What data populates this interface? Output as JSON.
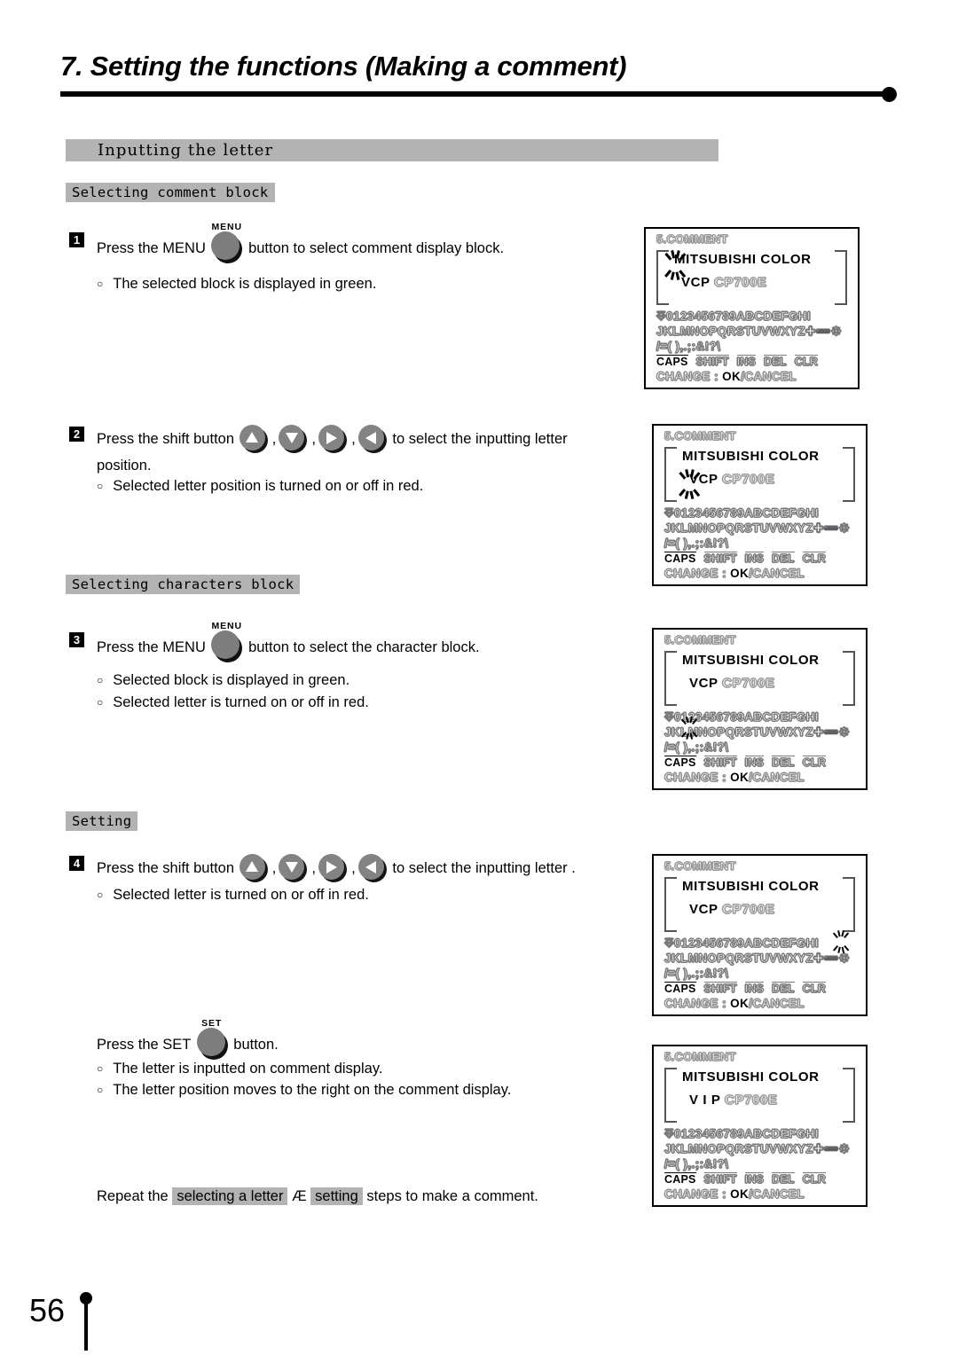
{
  "page": {
    "title": "7. Setting the functions (Making a comment)",
    "number": "56"
  },
  "sections": {
    "main_bar": "Inputting the letter",
    "selecting_comment_block": "Selecting comment block",
    "selecting_characters_block": "Selecting characters block",
    "setting": "Setting"
  },
  "steps": [
    {
      "num": "1",
      "text_before": "Press the MENU",
      "button_label": "MENU",
      "text_after": "button to select comment display block.",
      "bullets": [
        "The selected block is displayed in green."
      ]
    },
    {
      "num": "2",
      "text_before": "Press the shift button",
      "text_after": "to select the inputting letter",
      "text_wrap": "position.",
      "bullets": [
        "Selected letter position is turned on or off in red."
      ]
    },
    {
      "num": "3",
      "text_before": "Press the MENU",
      "button_label": "MENU",
      "text_after": "button to select the character block.",
      "bullets": [
        "Selected block is displayed in green.",
        "Selected letter is turned on or off in red."
      ]
    },
    {
      "num": "4",
      "text_before": "Press the shift button",
      "text_after": "to select the inputting letter .",
      "bullets": [
        "Selected letter is turned on or off in red."
      ]
    }
  ],
  "set_step": {
    "text_before": "Press the SET",
    "button_label": "SET",
    "text_after": "button.",
    "bullets": [
      "The letter is inputted on comment display.",
      "The letter position moves to the right on the comment display."
    ]
  },
  "footer": {
    "repeat_prefix": "Repeat the",
    "highlight_1": "selecting a letter",
    "arrow": "Æ",
    "highlight_2": "setting",
    "repeat_suffix": "steps to make a comment."
  },
  "arrow_buttons": {
    "up": "up-arrow",
    "down": "down-arrow",
    "right": "right-arrow",
    "left": "left-arrow",
    "separator": ","
  },
  "lcd": {
    "title": "5.COMMENT",
    "char_row_1": "⎑0123456789ABCDEFGHI",
    "char_row_2": "JKLMNOPQRSTUVWXYZ✚➖❉",
    "char_row_3": "/=( ),.;:&!?\\",
    "function_keys": [
      {
        "label": "CAPS",
        "active": true
      },
      {
        "label": "SHIFT",
        "active": false
      },
      {
        "label": "INS",
        "active": false
      },
      {
        "label": "DEL",
        "active": false
      },
      {
        "label": "CLR",
        "active": false
      }
    ],
    "change_label": "CHANGE",
    "change_colon": ":",
    "change_ok": "OK",
    "change_cancel": "/CANCEL",
    "panels": [
      {
        "id": "panel-1",
        "comment_line1_solid": "MITSUBISHI COLOR",
        "comment_line1_ghost": "",
        "comment_line2_solid": "VCP",
        "comment_line2_ghost": "CP700E",
        "blink": "comment-line1-first-letter"
      },
      {
        "id": "panel-2",
        "comment_line1_solid": "MITSUBISHI COLOR",
        "comment_line1_ghost": "",
        "comment_line2_solid": "VCP",
        "comment_line2_ghost": "CP700E",
        "blink": "comment-line2-vcp"
      },
      {
        "id": "panel-3",
        "comment_line1_solid": "MITSUBISHI COLOR",
        "comment_line1_ghost": "",
        "comment_line2_solid": "VCP",
        "comment_line2_ghost": "CP700E",
        "blink": "character-row2-letter-L"
      },
      {
        "id": "panel-4",
        "comment_line1_solid": "MITSUBISHI COLOR",
        "comment_line1_ghost": "",
        "comment_line2_solid": "VCP",
        "comment_line2_ghost": "CP700E",
        "blink": "character-row1-letter-I"
      },
      {
        "id": "panel-5",
        "comment_line1_solid": "MITSUBISHI COLOR",
        "comment_line1_ghost": "",
        "comment_line2_solid": "V I P",
        "comment_line2_ghost": "CP700E",
        "blink": "none"
      }
    ]
  }
}
